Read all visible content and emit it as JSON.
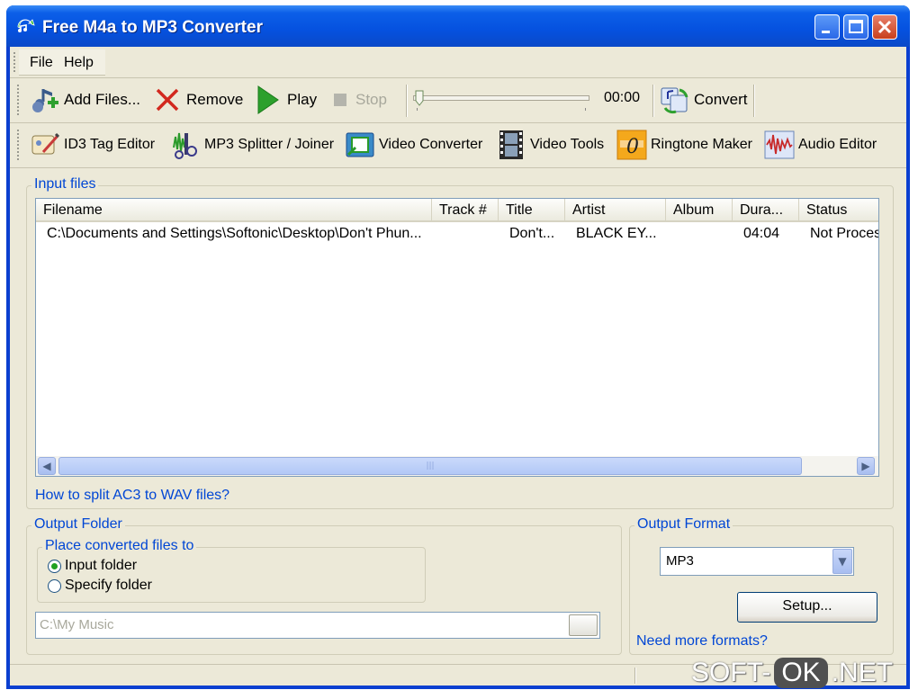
{
  "window": {
    "title": "Free M4a to MP3 Converter"
  },
  "menu": {
    "file": "File",
    "help": "Help"
  },
  "toolbar": {
    "add_files": "Add Files...",
    "remove": "Remove",
    "play": "Play",
    "stop": "Stop",
    "time": "00:00",
    "convert": "Convert",
    "playback_position": 0
  },
  "tools": {
    "id3": "ID3 Tag Editor",
    "splitter": "MP3 Splitter / Joiner",
    "video_converter": "Video Converter",
    "video_tools": "Video Tools",
    "ringtone": "Ringtone Maker",
    "audio_editor": "Audio Editor"
  },
  "input_files": {
    "label": "Input files",
    "columns": [
      "Filename",
      "Track #",
      "Title",
      "Artist",
      "Album",
      "Dura...",
      "Status"
    ],
    "rows": [
      {
        "filename": "C:\\Documents and Settings\\Softonic\\Desktop\\Don't Phun...",
        "track": "",
        "title": "Don't...",
        "artist": "BLACK EY...",
        "album": "",
        "duration": "04:04",
        "status": "Not Proces"
      }
    ],
    "scroll_grip": "|||"
  },
  "help_link": "How to split AC3 to WAV files?",
  "output_folder": {
    "label": "Output Folder",
    "group_label": "Place converted files to",
    "option_input": "Input folder",
    "option_specify": "Specify folder",
    "selected": "Input folder",
    "path": "C:\\My Music"
  },
  "output_format": {
    "label": "Output Format",
    "value": "MP3",
    "setup": "Setup...",
    "more_link": "Need more formats?"
  },
  "watermark": {
    "left": "SOFT-",
    "mid": "OK",
    "right": ".NET"
  }
}
